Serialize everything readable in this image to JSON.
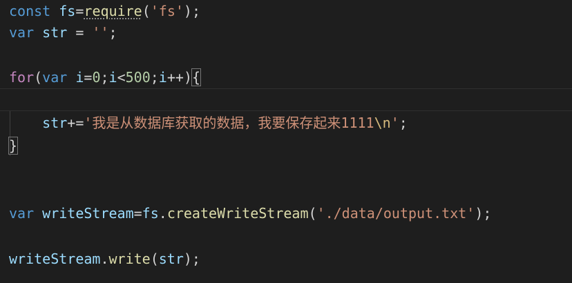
{
  "code": {
    "l1": {
      "kw": "const",
      "id": "fs",
      "op": "=",
      "fn": "require",
      "open": "(",
      "str": "'fs'",
      "close": ");"
    },
    "l2": {
      "kw": "var",
      "id": "str",
      "op": " = ",
      "str": "''",
      "end": ";"
    },
    "l4": {
      "ctl": "for",
      "open": "(",
      "kw": "var",
      "id1": "i",
      "op1": "=",
      "n1": "0",
      "semi1": ";",
      "id2": "i",
      "op2": "<",
      "n2": "500",
      "semi2": ";",
      "id3": "i",
      "op3": "++",
      "close": ")",
      "brace": "{"
    },
    "l6": {
      "id": "str",
      "op": "+=",
      "str_open": "'我是从数据库获取的数据，我要保存起来1111",
      "esc": "\\n",
      "str_close": "'",
      "end": ";"
    },
    "l7": {
      "brace": "}"
    },
    "l10": {
      "kw": "var",
      "id": "writeStream",
      "op": "=",
      "obj": "fs",
      "dot": ".",
      "fn": "createWriteStream",
      "open": "(",
      "str": "'./data/output.txt'",
      "close": ");"
    },
    "l12": {
      "obj": "writeStream",
      "dot": ".",
      "fn": "write",
      "open": "(",
      "arg": "str",
      "close": ");"
    }
  }
}
